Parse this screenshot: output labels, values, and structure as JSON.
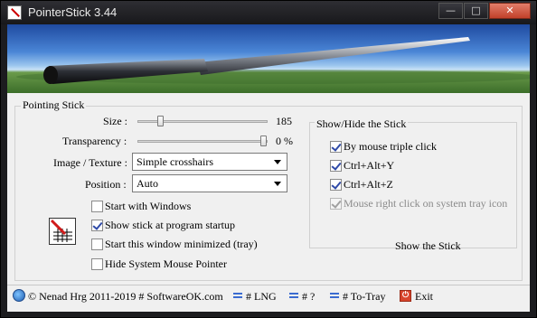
{
  "window": {
    "title": "PointerStick 3.44",
    "buttons": {
      "minimize": "—",
      "maximize": "□",
      "close": "✕"
    }
  },
  "pointing_stick": {
    "group_label": "Pointing Stick",
    "size": {
      "label": "Size :",
      "value": "185",
      "level": 0.16
    },
    "transparency": {
      "label": "Transparency :",
      "value": "0 %",
      "level": 0.99
    },
    "image_texture": {
      "label": "Image / Texture :",
      "selected": "Simple crosshairs"
    },
    "position": {
      "label": "Position :",
      "selected": "Auto"
    },
    "options": [
      {
        "label": "Start with Windows",
        "checked": false
      },
      {
        "label": "Show stick at program startup",
        "checked": true
      },
      {
        "label": "Start this window minimized (tray)",
        "checked": false
      },
      {
        "label": "Hide System Mouse Pointer",
        "checked": false
      }
    ]
  },
  "show_hide": {
    "group_label": "Show/Hide the Stick",
    "options": [
      {
        "label": "By mouse triple click",
        "checked": true,
        "disabled": false
      },
      {
        "label": "Ctrl+Alt+Y",
        "checked": true,
        "disabled": false
      },
      {
        "label": "Ctrl+Alt+Z",
        "checked": true,
        "disabled": false
      },
      {
        "label": "Mouse right click on system tray icon",
        "checked": true,
        "disabled": true
      }
    ],
    "show_button": "Show the Stick"
  },
  "footer": {
    "copyright": "© Nenad Hrg 2011-2019 # SoftwareOK.com",
    "lng": "# LNG",
    "help": "# ?",
    "to_tray": "# To-Tray",
    "exit": "Exit"
  },
  "colors": {
    "title_bar": "#1c1c1f",
    "client_bg": "#f0f0f0",
    "check_mark": "#2f4aa8",
    "disabled_text": "#8a8a8a"
  },
  "icons": [
    "app-icon",
    "banner-stick-image",
    "crosshair-logo-icon",
    "globe-icon",
    "menu-icon",
    "exit-icon"
  ]
}
